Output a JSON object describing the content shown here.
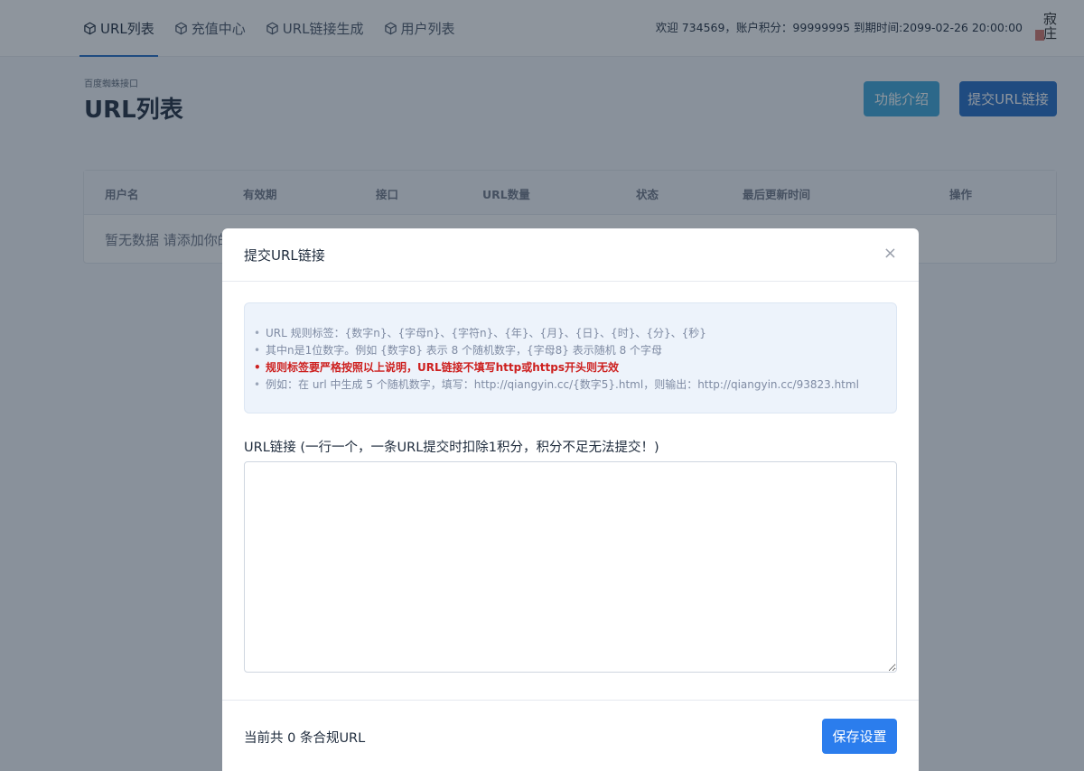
{
  "nav": {
    "items": [
      {
        "label": "URL列表",
        "icon": "box-icon",
        "active": true
      },
      {
        "label": "充值中心",
        "icon": "box-icon",
        "active": false
      },
      {
        "label": "URL链接生成",
        "icon": "box-icon",
        "active": false
      },
      {
        "label": "用户列表",
        "icon": "box-icon",
        "active": false
      }
    ],
    "user_info": "欢迎 734569，账户积分：99999995 到期时间:2099-02-26 20:00:00",
    "avatar_text": "寂庄"
  },
  "page": {
    "pretitle": "百度蜘蛛接口",
    "title": "URL列表",
    "intro_button": "功能介绍",
    "submit_button": "提交URL链接"
  },
  "table": {
    "headers": [
      "用户名",
      "有效期",
      "接口",
      "URL数量",
      "状态",
      "最后更新时间",
      "操作"
    ],
    "empty_text": "暂无数据 请添加你的"
  },
  "modal": {
    "title": "提交URL链接",
    "close": "×",
    "notes": [
      "URL 规则标签：{数字n}、{字母n}、{字符n}、{年}、{月}、{日}、{时}、{分}、{秒}",
      "其中n是1位数字。例如 {数字8} 表示 8 个随机数字，{字母8} 表示随机 8 个字母",
      "规则标签要严格按照以上说明，URL链接不填写http或https开头则无效",
      "例如：在 url 中生成 5 个随机数字，填写：http://qiangyin.cc/{数字5}.html，则输出：http://qiangyin.cc/93823.html"
    ],
    "field_label": "URL链接 (一行一个，一条URL提交时扣除1积分，积分不足无法提交！)",
    "textarea_value": "",
    "footer_text": "当前共 0 条合规URL",
    "save_button": "保存设置"
  },
  "colors": {
    "primary": "#206bc4",
    "info": "#3aa5d8",
    "danger": "#cd201f"
  }
}
